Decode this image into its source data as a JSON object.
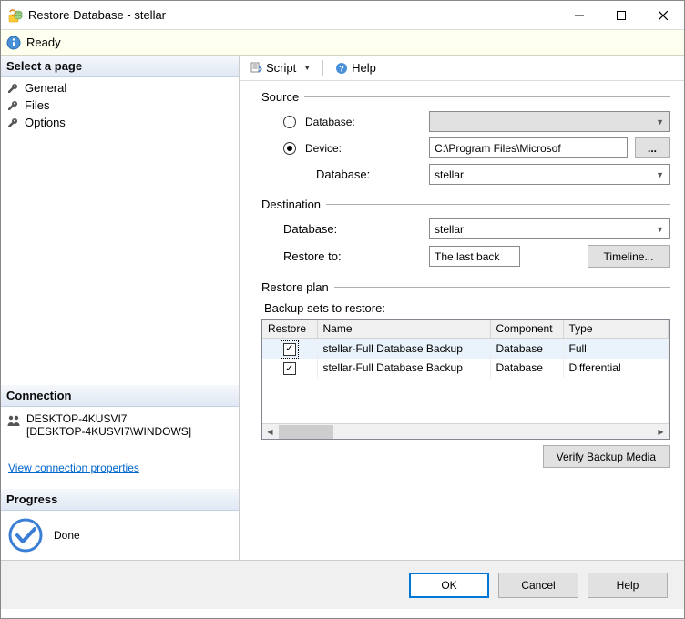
{
  "window": {
    "title": "Restore Database - stellar"
  },
  "status": {
    "text": "Ready"
  },
  "pages": {
    "header": "Select a page",
    "items": [
      "General",
      "Files",
      "Options"
    ]
  },
  "connection": {
    "header": "Connection",
    "server": "DESKTOP-4KUSVI7",
    "detail": "[DESKTOP-4KUSVI7\\WINDOWS]",
    "link": "View connection properties"
  },
  "progress": {
    "header": "Progress",
    "text": "Done"
  },
  "toolbar": {
    "script": "Script",
    "help": "Help"
  },
  "source": {
    "title": "Source",
    "db_label": "Database:",
    "device_label": "Device:",
    "device_value": "C:\\Program Files\\Microsof",
    "db2_label": "Database:",
    "db2_value": "stellar"
  },
  "destination": {
    "title": "Destination",
    "db_label": "Database:",
    "db_value": "stellar",
    "restore_to_label": "Restore to:",
    "restore_to_value": "The last back",
    "timeline_btn": "Timeline..."
  },
  "restore_plan": {
    "title": "Restore plan",
    "subtitle": "Backup sets to restore:",
    "columns": [
      "Restore",
      "Name",
      "Component",
      "Type"
    ],
    "rows": [
      {
        "restore": true,
        "name": "stellar-Full Database Backup",
        "component": "Database",
        "type": "Full"
      },
      {
        "restore": true,
        "name": "stellar-Full Database Backup",
        "component": "Database",
        "type": "Differential"
      }
    ],
    "verify_btn": "Verify Backup Media"
  },
  "buttons": {
    "ok": "OK",
    "cancel": "Cancel",
    "help": "Help"
  }
}
